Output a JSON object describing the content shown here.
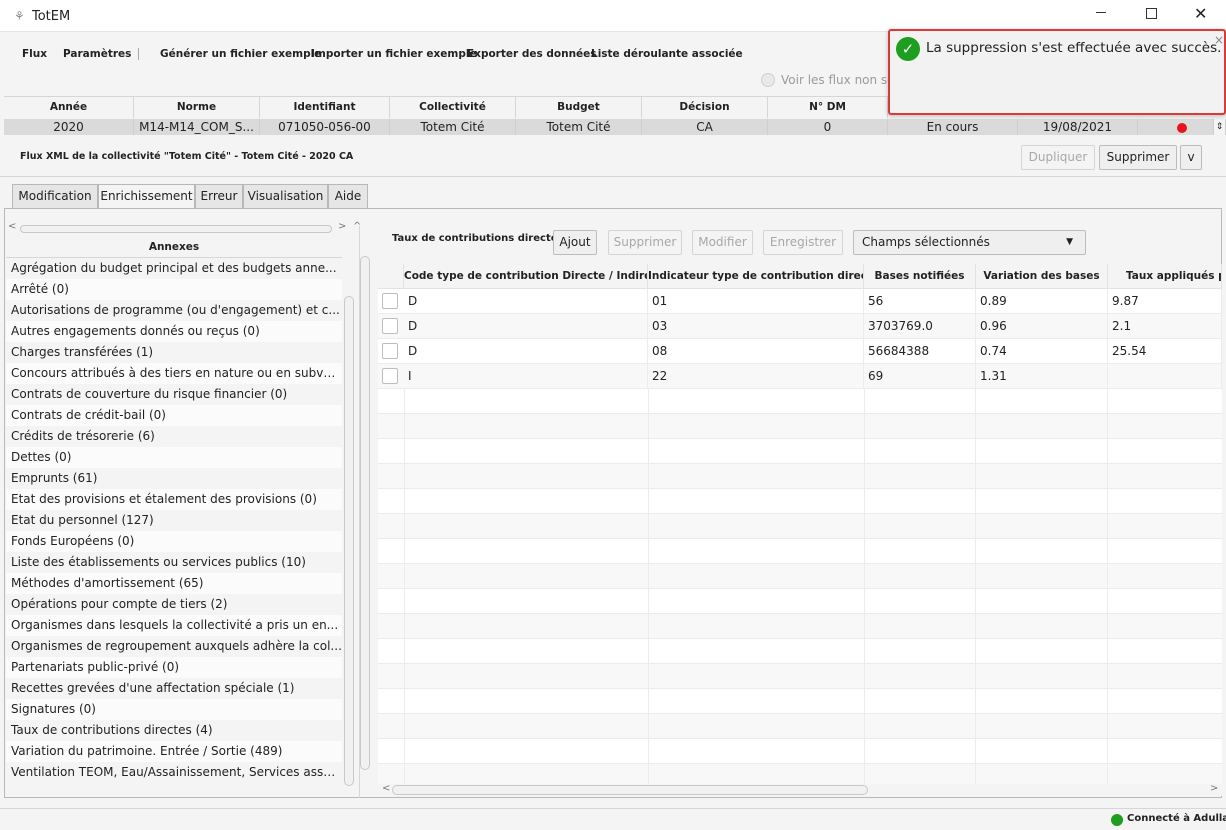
{
  "window": {
    "title": "TotEM"
  },
  "menu": [
    "Flux",
    "Paramètres",
    "Générer un fichier exemple",
    "Importer un fichier exemple",
    "Exporter des données",
    "Liste déroulante associée"
  ],
  "flux_toggle_label": "Voir les flux non so",
  "flux_table": {
    "headers": [
      "Année",
      "Norme",
      "Identifiant",
      "Collectivité",
      "Budget",
      "Décision",
      "N° DM"
    ],
    "row": [
      "2020",
      "M14-M14_COM_S...",
      "071050-056-00",
      "Totem Cité",
      "Totem Cité",
      "CA",
      "0",
      "En cours",
      "19/08/2021"
    ],
    "status_dot_color": "#e8141b"
  },
  "flux_caption": "Flux XML de la collectivité \"Totem Cité\" - Totem Cité - 2020 CA",
  "actions": {
    "dupliquer": "Dupliquer",
    "supprimer": "Supprimer",
    "more": "v"
  },
  "tabs": [
    "Modification",
    "Enrichissement",
    "Erreur",
    "Visualisation",
    "Aide"
  ],
  "annexes": {
    "header": "Annexes",
    "items": [
      "Agrégation du budget principal et des budgets anne...",
      "Arrêté (0)",
      "Autorisations de programme (ou d'engagement) et c...",
      "Autres engagements donnés ou reçus (0)",
      "Charges transférées (1)",
      "Concours attribués à des tiers en nature ou en subve...",
      "Contrats de couverture du risque financier (0)",
      "Contrats de crédit-bail (0)",
      "Crédits de trésorerie (6)",
      "Dettes (0)",
      "Emprunts (61)",
      "Etat des provisions et étalement des provisions (0)",
      "Etat du personnel (127)",
      "Fonds Européens (0)",
      "Liste des établissements ou services publics (10)",
      "Méthodes d'amortissement (65)",
      "Opérations pour compte de tiers (2)",
      "Organismes dans lesquels la collectivité a pris un en...",
      "Organismes de regroupement auxquels adhère la col...",
      "Partenariats public-privé (0)",
      "Recettes grevées d'une affectation spéciale (1)",
      "Signatures (0)",
      "Taux de contributions directes (4)",
      "Variation du patrimoine. Entrée / Sortie (489)",
      "Ventilation TEOM, Eau/Assainissement, Services assu..."
    ]
  },
  "detail": {
    "title": "Taux de contributions directes",
    "buttons": {
      "ajout": "Ajout",
      "supprimer": "Supprimer",
      "modifier": "Modifier",
      "enregistrer": "Enregistrer"
    },
    "select_value": "Champs sélectionnés",
    "headers": [
      "Code type de contribution Directe / Indirecte",
      "Indicateur type de contribution directe",
      "Bases notifiées",
      "Variation des bases",
      "Taux appliqués p"
    ],
    "rows": [
      [
        "D",
        "01",
        "56",
        "0.89",
        "9.87"
      ],
      [
        "D",
        "03",
        "3703769.0",
        "0.96",
        "2.1"
      ],
      [
        "D",
        "08",
        "56684388",
        "0.74",
        "25.54"
      ],
      [
        "I",
        "22",
        "69",
        "1.31",
        ""
      ]
    ]
  },
  "toast": {
    "message": "La suppression s'est effectuée avec succès.",
    "close": "×"
  },
  "status": {
    "text": "Connecté à Adullact",
    "color": "#1e9e1e"
  }
}
